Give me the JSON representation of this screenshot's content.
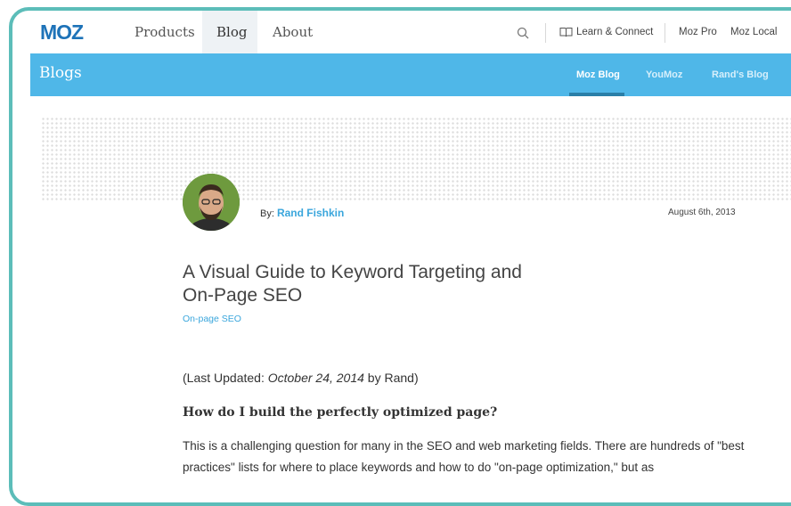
{
  "brand": {
    "logo_text": "MOZ",
    "accent": "#4fb7e8",
    "frame": "#5cbdb9"
  },
  "topnav": {
    "items": [
      {
        "label": "Products"
      },
      {
        "label": "Blog",
        "active": true
      },
      {
        "label": "About"
      }
    ],
    "search_icon": "search-icon",
    "learn_label": "Learn & Connect",
    "learn_icon": "book-icon",
    "moz_pro": "Moz Pro",
    "moz_local": "Moz Local"
  },
  "blogbar": {
    "title": "Blogs",
    "tabs": [
      {
        "label": "Moz Blog",
        "active": true
      },
      {
        "label": "YouMoz"
      },
      {
        "label": "Rand's Blog"
      }
    ]
  },
  "post": {
    "by_label": "By:",
    "author": "Rand Fishkin",
    "date": "August 6th, 2013",
    "title": "A Visual Guide to Keyword Targeting and On-Page SEO",
    "category": "On-page SEO",
    "updated_prefix": "(Last Updated: ",
    "updated_date": "October 24, 2014",
    "updated_suffix": " by Rand)",
    "heading": "How do I build the perfectly optimized page?",
    "paragraph": "This is a challenging question for many in the SEO and web marketing fields. There are hundreds of \"best practices\" lists for where to place keywords and how to do \"on-page optimization,\" but as"
  }
}
